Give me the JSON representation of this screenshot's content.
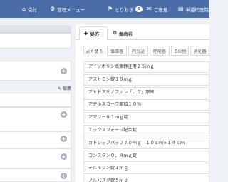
{
  "nav": {
    "items": [
      {
        "icon": "⌂",
        "icon_name": "home-icon",
        "label": "受付"
      },
      {
        "icon": "⚙",
        "icon_name": "gear-icon",
        "label": "管理メニュー"
      },
      {
        "icon": "⚑",
        "icon_name": "user-flag-icon",
        "label": "とりおき",
        "badge": "5"
      },
      {
        "icon": "✉",
        "icon_name": "mail-icon",
        "label": "ご意見"
      },
      {
        "icon": "▤",
        "icon_name": "document-icon",
        "label": "半還門医院"
      }
    ],
    "bg_color": "#4a6da8"
  },
  "left": {
    "edit_label": "✎ 編集"
  },
  "tabs": [
    {
      "icon": "✚",
      "icon_name": "prescription-icon",
      "label": "処方"
    },
    {
      "icon": "⧉",
      "icon_name": "disease-name-icon",
      "label": "傷病名"
    }
  ],
  "categories": [
    "よく使う",
    "循環器",
    "内分泌",
    "呼吸器",
    "その他",
    "消化器"
  ],
  "drugs": [
    "アイソボリン点滴静注用２５ｍｇ",
    "アストミン錠１０ｍｇ",
    "アセトアミノフェン「ＪＧ」原末",
    "アデホスコーワ顆粒１０％",
    "アマリール１ｍｇ錠",
    "エックスフォージ配合錠",
    "カトレップパップ７０ｍｇ　１０ｃｍ×１４ｃｍ",
    "コンスタン０．４ｍｇ錠",
    "テルネリン錠１ｍｇ",
    "ノルバスク錠５ｍｇ"
  ]
}
